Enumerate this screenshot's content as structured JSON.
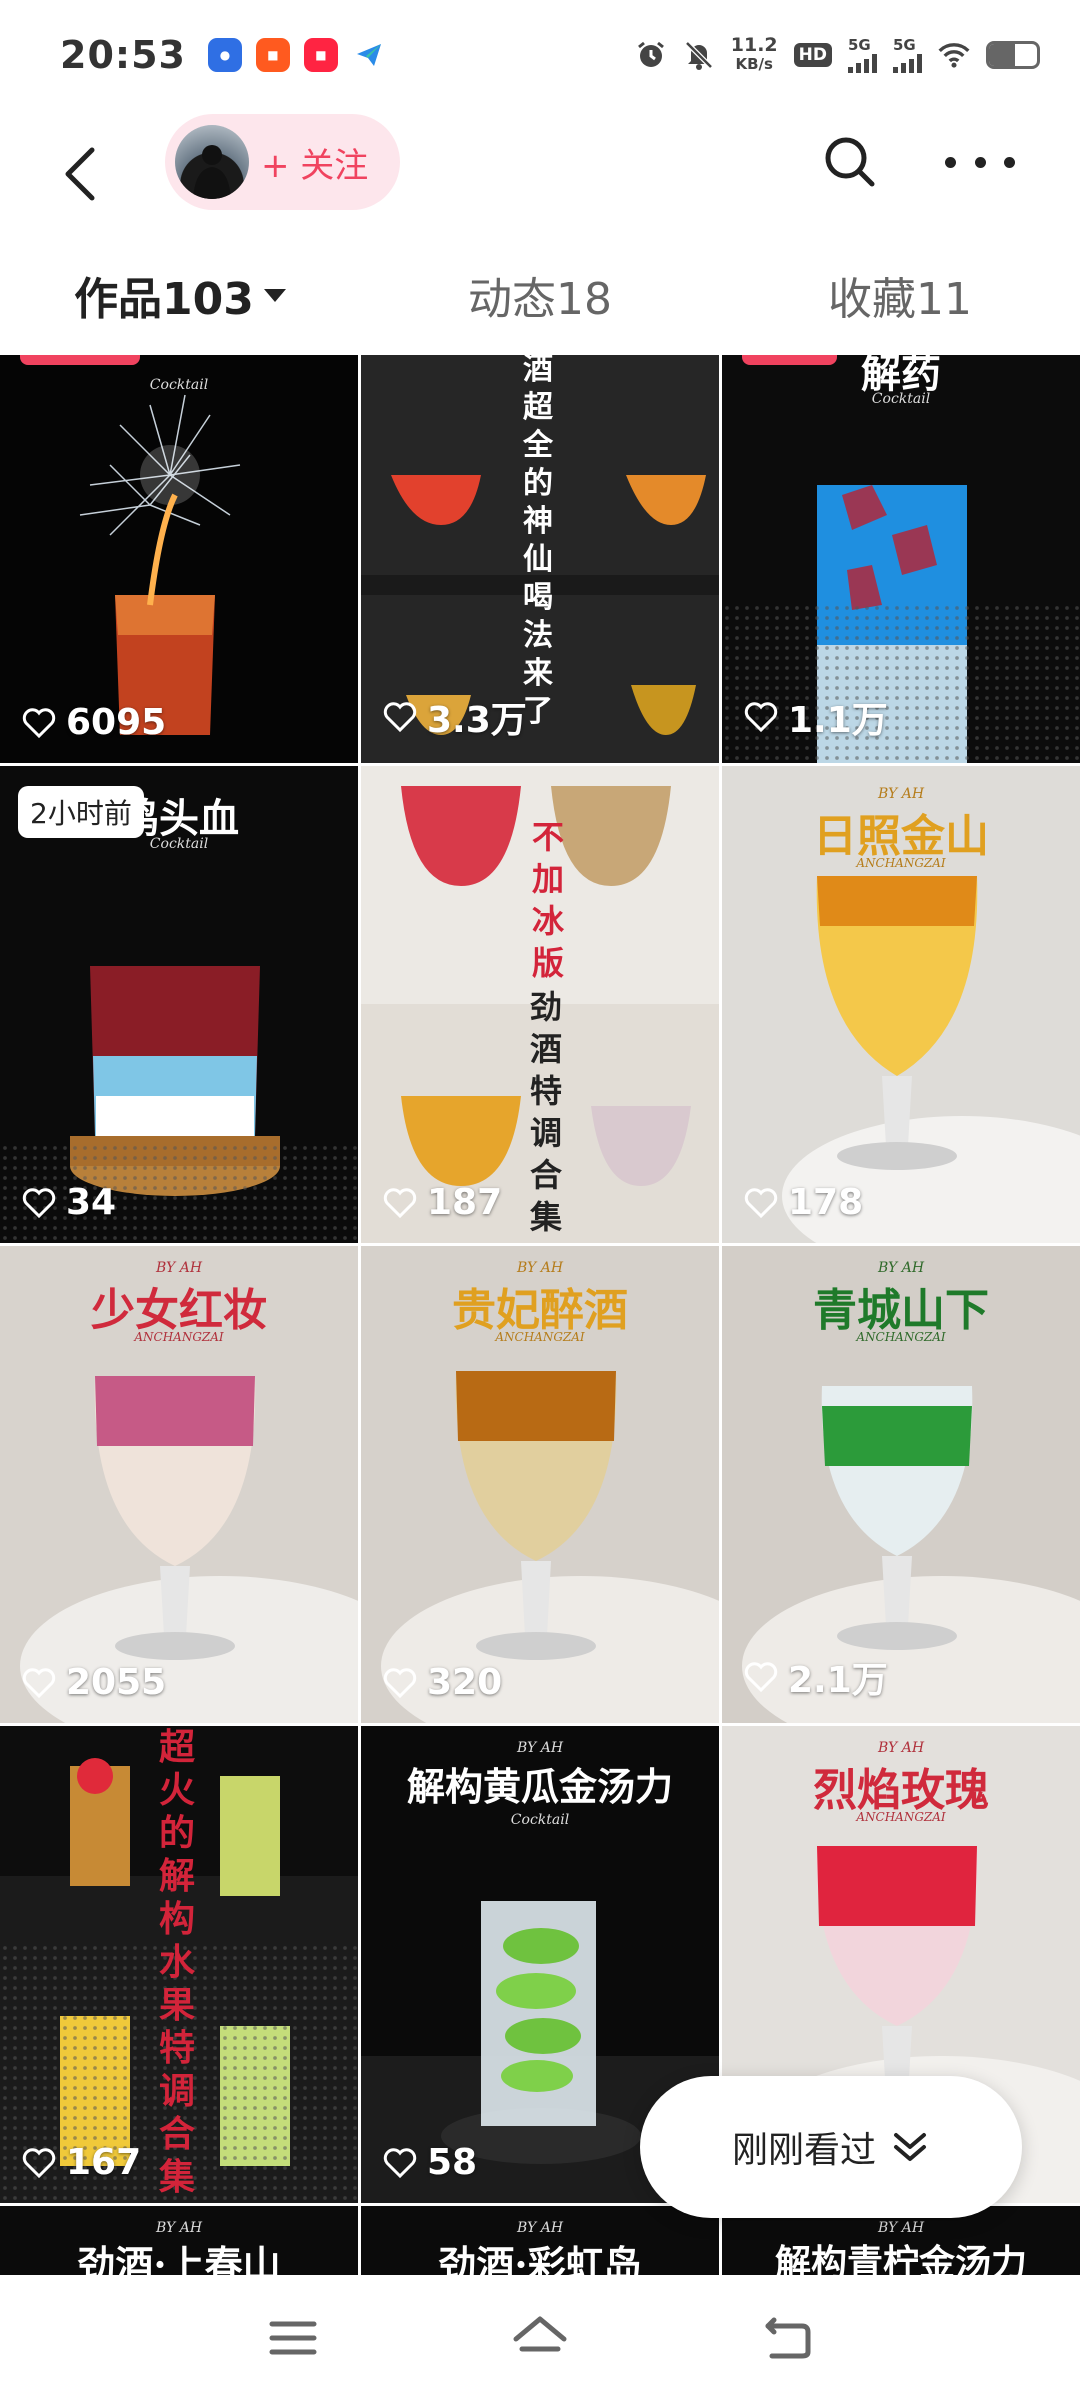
{
  "status_bar": {
    "time": "20:53",
    "net_speed_value": "11.2",
    "net_speed_unit": "KB/s",
    "hd_label": "HD",
    "sim1_label": "5G",
    "sim2_label": "5G",
    "battery_level": 0.55
  },
  "header": {
    "follow_label": "+ 关注"
  },
  "tabs": [
    {
      "label": "作品103",
      "active": true
    },
    {
      "label": "动态18",
      "active": false
    },
    {
      "label": "收藏11",
      "active": false
    }
  ],
  "tiles": [
    {
      "likes": "6095",
      "sub": "Cocktail"
    },
    {
      "title_v": "酒超全的神仙喝法来了",
      "likes": "3.3万"
    },
    {
      "title": "解药",
      "sub": "Cocktail",
      "likes": "1.1万"
    },
    {
      "badge": "2小时前",
      "title": "鸡头血",
      "sub": "Cocktail",
      "likes": "34"
    },
    {
      "title_v1": "不加冰版",
      "title_v2": "劲酒特调合集",
      "likes": "187"
    },
    {
      "title": "日照金山",
      "by": "BY AH",
      "brand": "ANCHANGZAI",
      "likes": "178"
    },
    {
      "title": "少女红妆",
      "by": "BY AH",
      "brand": "ANCHANGZAI",
      "likes": "2055"
    },
    {
      "title": "贵妃醉酒",
      "by": "BY AH",
      "brand": "ANCHANGZAI",
      "likes": "320"
    },
    {
      "title": "青城山下",
      "by": "BY AH",
      "brand": "ANCHANGZAI",
      "likes": "2.1万"
    },
    {
      "title_v": "超火的解构水果特调合集",
      "likes": "167"
    },
    {
      "title": "解构黄瓜金汤力",
      "by": "BY AH",
      "sub": "Cocktail",
      "likes": "58"
    },
    {
      "title": "烈焰玫瑰",
      "by": "BY AH",
      "brand": "ANCHANGZAI"
    },
    {
      "title": "劲酒·上春山",
      "by": "BY AH"
    },
    {
      "title": "劲酒·彩虹岛",
      "by": "BY AH"
    },
    {
      "title": "解构青柠金汤力",
      "by": "BY AH"
    }
  ],
  "recent_viewed_label": "刚刚看过",
  "colors": {
    "accent": "#f0435f",
    "follow_bg": "#fde6ec"
  }
}
